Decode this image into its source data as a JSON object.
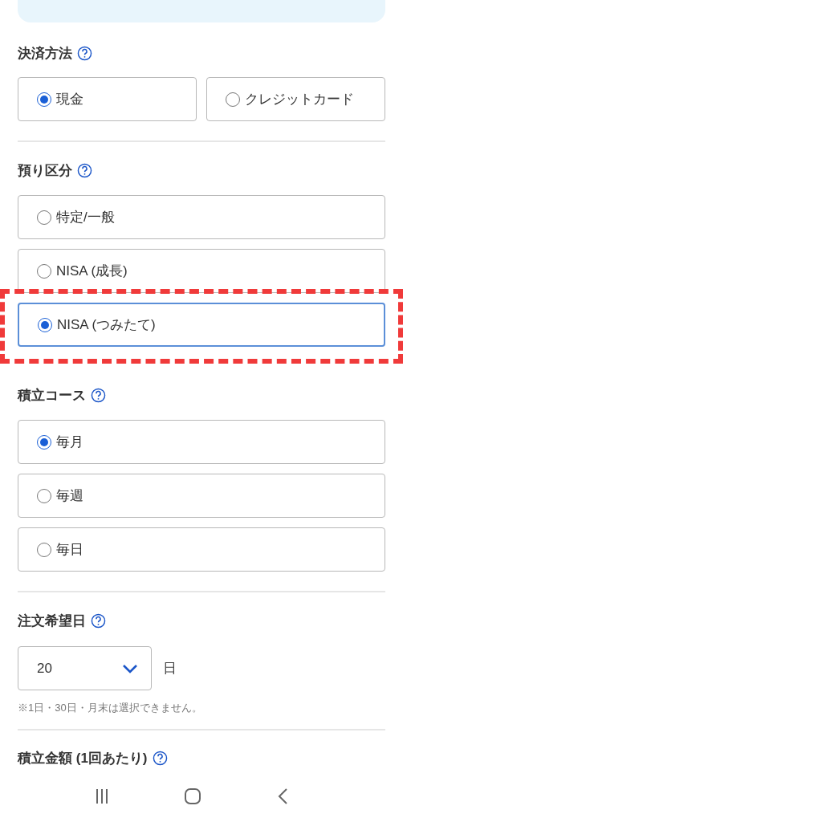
{
  "sections": [
    {
      "kind": "radio_row",
      "label": "決済方法",
      "divider_after": true,
      "options": [
        {
          "label": "現金",
          "selected": true,
          "focused": false,
          "highlighted": false
        },
        {
          "label": "クレジットカード",
          "selected": false,
          "focused": false,
          "highlighted": false
        }
      ]
    },
    {
      "kind": "radio_list",
      "label": "預り区分",
      "divider_after": false,
      "options": [
        {
          "label": "特定/一般",
          "selected": false,
          "focused": false,
          "highlighted": false
        },
        {
          "label": "NISA (成長)",
          "selected": false,
          "focused": false,
          "highlighted": false
        },
        {
          "label": "NISA (つみたて)",
          "selected": true,
          "focused": true,
          "highlighted": true
        }
      ]
    },
    {
      "kind": "radio_list",
      "label": "積立コース",
      "divider_after": true,
      "options": [
        {
          "label": "毎月",
          "selected": true,
          "focused": false,
          "highlighted": false
        },
        {
          "label": "毎週",
          "selected": false,
          "focused": false,
          "highlighted": false
        },
        {
          "label": "毎日",
          "selected": false,
          "focused": false,
          "highlighted": false
        }
      ]
    },
    {
      "kind": "select",
      "label": "注文希望日",
      "divider_after": true,
      "value": "20",
      "unit": "日",
      "note": "※1日・30日・月末は選択できません。"
    },
    {
      "kind": "heading",
      "label": "積立金額 (1回あたり)"
    }
  ]
}
